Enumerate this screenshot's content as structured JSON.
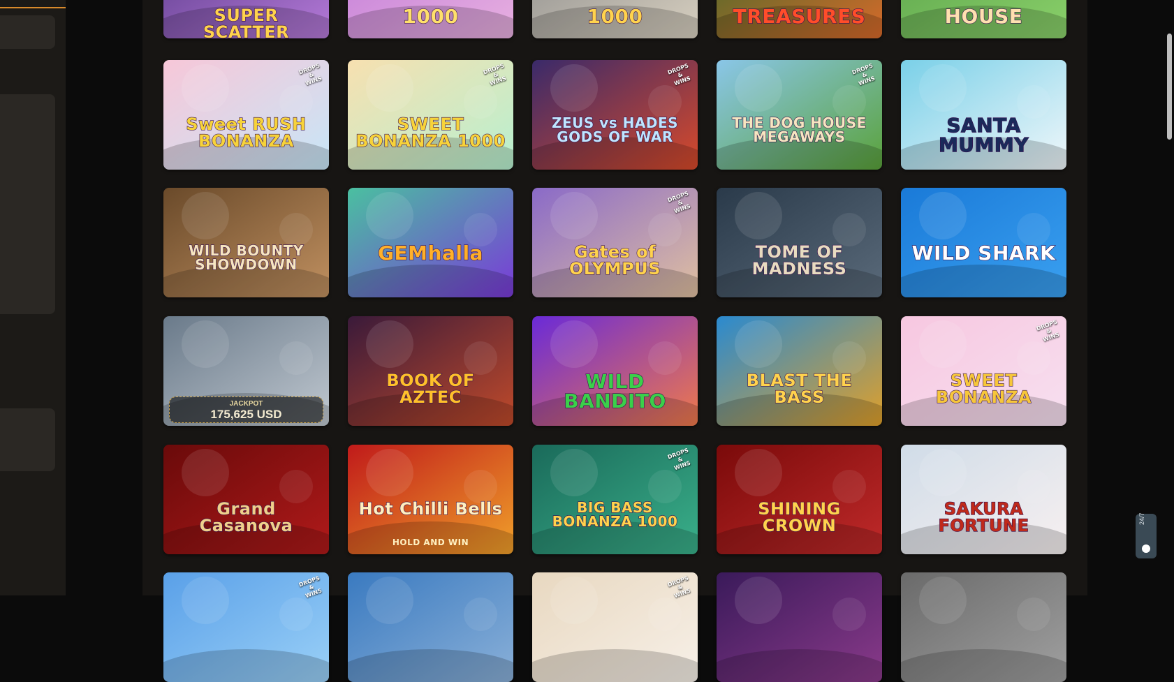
{
  "support": {
    "label": "24/7"
  },
  "rows": [
    [
      {
        "title": "SUPER SCATTER",
        "bg": [
          "#5a3a8a",
          "#b57ad8"
        ],
        "color": "#ffd34d"
      },
      {
        "title": "1000",
        "bg": [
          "#c07ad8",
          "#e8b0e0"
        ],
        "color": "#ffe06b"
      },
      {
        "title": "1000",
        "bg": [
          "#8a8a8a",
          "#d8d0c0"
        ],
        "color": "#ffd34d"
      },
      {
        "title": "TREASURES",
        "bg": [
          "#3a6a2a",
          "#d86a2a"
        ],
        "color": "#ff4d2a"
      },
      {
        "title": "HOUSE",
        "bg": [
          "#5aa24a",
          "#8ad06a"
        ],
        "color": "#ffe0b0"
      }
    ],
    [
      {
        "title": "Sweet RUSH BONANZA",
        "tag": "DROPS & WINS",
        "bg": [
          "#f7c7d8",
          "#c7e6f7"
        ],
        "color": "#f7d33a"
      },
      {
        "title": "SWEET BONANZA 1000",
        "tag": "DROPS & WINS",
        "bg": [
          "#f7e0b0",
          "#b7f0d0"
        ],
        "color": "#f7d33a"
      },
      {
        "title": "ZEUS vs HADES GODS OF WAR",
        "tag": "DROPS & WINS",
        "bg": [
          "#3a2a6a",
          "#d84a2a"
        ],
        "color": "#bfe6ff"
      },
      {
        "title": "THE DOG HOUSE MEGAWAYS",
        "tag": "DROPS & WINS",
        "bg": [
          "#8ac6e8",
          "#5aa23a"
        ],
        "color": "#f7e6c0"
      },
      {
        "title": "SANTA MUMMY",
        "bg": [
          "#7ad0e8",
          "#f0f7fa"
        ],
        "color": "#1a2a5a"
      }
    ],
    [
      {
        "title": "WILD BOUNTY SHOWDOWN",
        "bg": [
          "#6a4a2a",
          "#c09060"
        ],
        "color": "#f7e6c0"
      },
      {
        "title": "GEMhalla",
        "bg": [
          "#4ac0a0",
          "#7a3ad8"
        ],
        "color": "#ffb02a"
      },
      {
        "title": "Gates of OLYMPUS",
        "tag": "DROPS & WINS",
        "bg": [
          "#8a6ac8",
          "#e0c0a0"
        ],
        "color": "#ffd34d"
      },
      {
        "title": "TOME OF MADNESS",
        "bg": [
          "#2a3a4a",
          "#5a6a7a"
        ],
        "color": "#e8dcc0"
      },
      {
        "title": "WILD SHARK",
        "bg": [
          "#1a7ad8",
          "#3aa0f0"
        ],
        "color": "#ffffff"
      }
    ],
    [
      {
        "title": "",
        "jackpot_label": "JACKPOT",
        "jackpot_value": "175,625 USD",
        "bg": [
          "#6a7a8a",
          "#c0c8d0"
        ],
        "color": "#ffffff"
      },
      {
        "title": "BOOK OF AZTEC",
        "bg": [
          "#3a1a3a",
          "#c04a2a"
        ],
        "color": "#ffc02a"
      },
      {
        "title": "WILD BANDITO",
        "bg": [
          "#6a2ad8",
          "#f07a4a"
        ],
        "color": "#3ad04a"
      },
      {
        "title": "BLAST THE BASS",
        "bg": [
          "#2a8ad0",
          "#e0a02a"
        ],
        "color": "#ffd34d"
      },
      {
        "title": "SWEET BONANZA",
        "tag": "DROPS & WINS",
        "bg": [
          "#f7c7e0",
          "#f7e0f0"
        ],
        "color": "#f7c73a"
      }
    ],
    [
      {
        "title": "Grand Casanova",
        "bg": [
          "#6a0a0a",
          "#b01a1a"
        ],
        "color": "#f0d08a"
      },
      {
        "title": "Hot Chilli Bells",
        "subtitle": "HOLD AND WIN",
        "bg": [
          "#c01a1a",
          "#f0a02a"
        ],
        "color": "#fff0c0"
      },
      {
        "title": "BIG BASS BONANZA 1000",
        "tag": "DROPS & WINS",
        "bg": [
          "#1a6a5a",
          "#3ab08a"
        ],
        "color": "#ffd34d"
      },
      {
        "title": "SHINING CROWN",
        "bg": [
          "#7a0a0a",
          "#c02a2a"
        ],
        "color": "#ffd34d"
      },
      {
        "title": "SAKURA FORTUNE",
        "bg": [
          "#d0dce8",
          "#f7f0f0"
        ],
        "color": "#c02a1a"
      }
    ],
    [
      {
        "title": "",
        "tag": "DROPS & WINS",
        "bg": [
          "#5aa0e8",
          "#9ad0f7"
        ],
        "color": "#ffffff"
      },
      {
        "title": "",
        "bg": [
          "#3a7ac0",
          "#8ab0d8"
        ],
        "color": "#ffffff"
      },
      {
        "title": "",
        "tag": "DROPS & WINS",
        "bg": [
          "#e8d8c0",
          "#f7f0e8"
        ],
        "color": "#ffffff"
      },
      {
        "title": "",
        "bg": [
          "#3a1a5a",
          "#8a3a8a"
        ],
        "color": "#ffffff"
      },
      {
        "title": "",
        "bg": [
          "#6a6a6a",
          "#a0a0a0"
        ],
        "color": "#ffffff"
      }
    ]
  ]
}
